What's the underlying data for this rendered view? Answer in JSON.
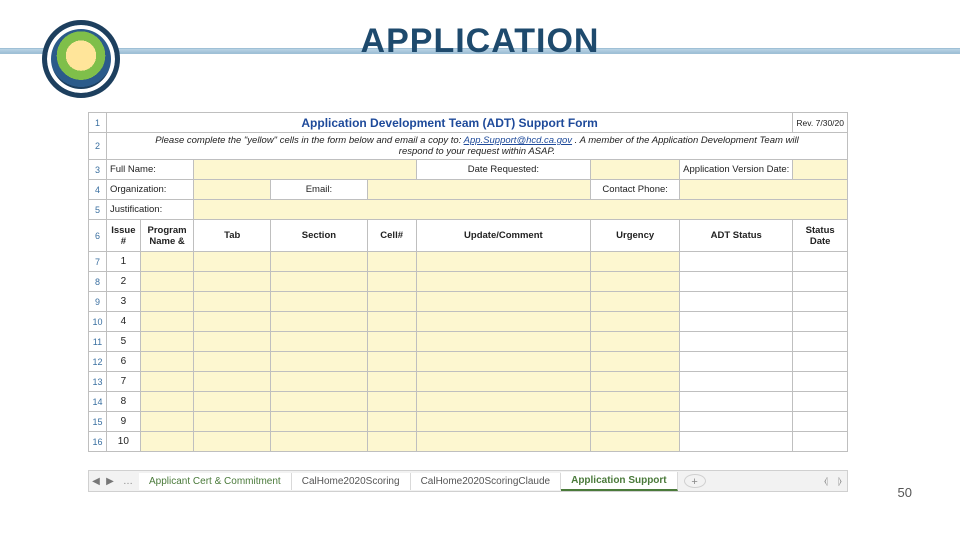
{
  "page": {
    "title": "APPLICATION",
    "number": "50"
  },
  "form": {
    "title": "Application Development Team (ADT) Support Form",
    "rev": "Rev. 7/30/20",
    "instructions_pre": "Please complete the \"yellow\" cells in the form below and email a copy to: ",
    "instructions_email": "App.Support@hcd.ca.gov",
    "instructions_post": ".  A member of the Application Development Team will",
    "instructions_line2": "respond to your request within ASAP.",
    "labels": {
      "full_name": "Full Name:",
      "date_requested": "Date Requested:",
      "app_version_date": "Application Version Date:",
      "organization": "Organization:",
      "email": "Email:",
      "contact_phone": "Contact Phone:",
      "justification": "Justification:"
    }
  },
  "columns": {
    "issue": "Issue #",
    "program": "Program Name &",
    "tab": "Tab",
    "section": "Section",
    "cell": "Cell#",
    "update": "Update/Comment",
    "urgency": "Urgency",
    "adt_status": "ADT Status",
    "status_date": "Status Date"
  },
  "row_numbers": [
    "1",
    "2",
    "3",
    "4",
    "5",
    "6",
    "7",
    "8",
    "9",
    "10",
    "11",
    "12",
    "13",
    "14",
    "15",
    "16"
  ],
  "issue_numbers": [
    "1",
    "2",
    "3",
    "4",
    "5",
    "6",
    "7",
    "8",
    "9",
    "10"
  ],
  "tabs": {
    "t1": "Applicant Cert & Commitment",
    "t2": "CalHome2020Scoring",
    "t3": "CalHome2020ScoringClaude",
    "active": "Application Support"
  }
}
